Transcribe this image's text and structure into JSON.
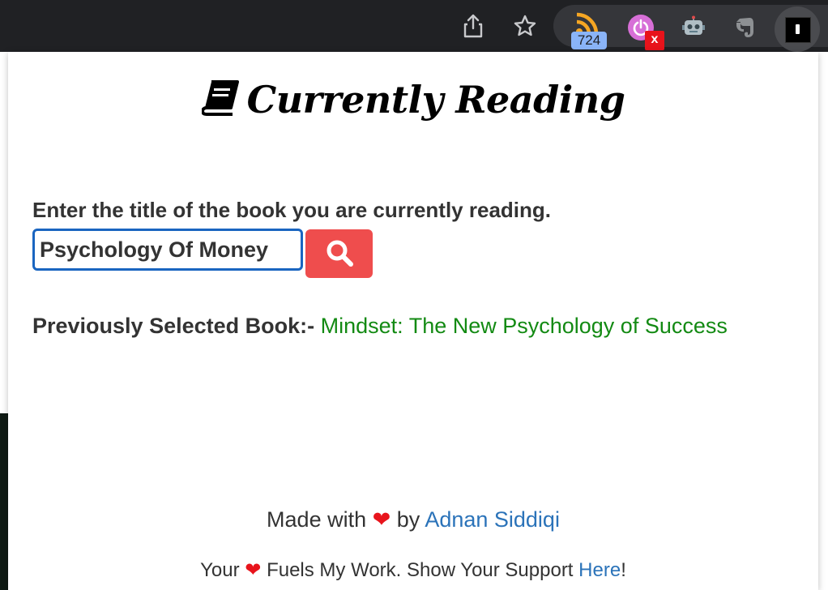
{
  "browser_toolbar": {
    "extensions": {
      "rss_badge_count": "724",
      "power_badge_text": "x"
    }
  },
  "popup": {
    "heading": "Currently Reading",
    "prompt": "Enter the title of the book you are currently reading.",
    "search": {
      "value": "Psychology Of Money"
    },
    "previous": {
      "label": "Previously Selected Book:-",
      "title": "Mindset: The New Psychology of Success"
    },
    "footer": {
      "made_with": "Made with",
      "heart": "❤",
      "by": "by",
      "author": "Adnan Siddiqi",
      "support_prefix": "Your",
      "support_middle": "Fuels My Work. Show Your Support",
      "support_link": "Here",
      "support_suffix": "!"
    }
  },
  "colors": {
    "accent_red": "#ef4d4d",
    "link_blue": "#2b73b9",
    "success_green": "#138a13",
    "input_border": "#1a65c0"
  },
  "icons": [
    "share-icon",
    "star-icon",
    "rss-icon",
    "power-icon",
    "robot-icon",
    "evernote-icon",
    "book-extension-icon",
    "book-icon",
    "search-icon",
    "heart-icon"
  ]
}
